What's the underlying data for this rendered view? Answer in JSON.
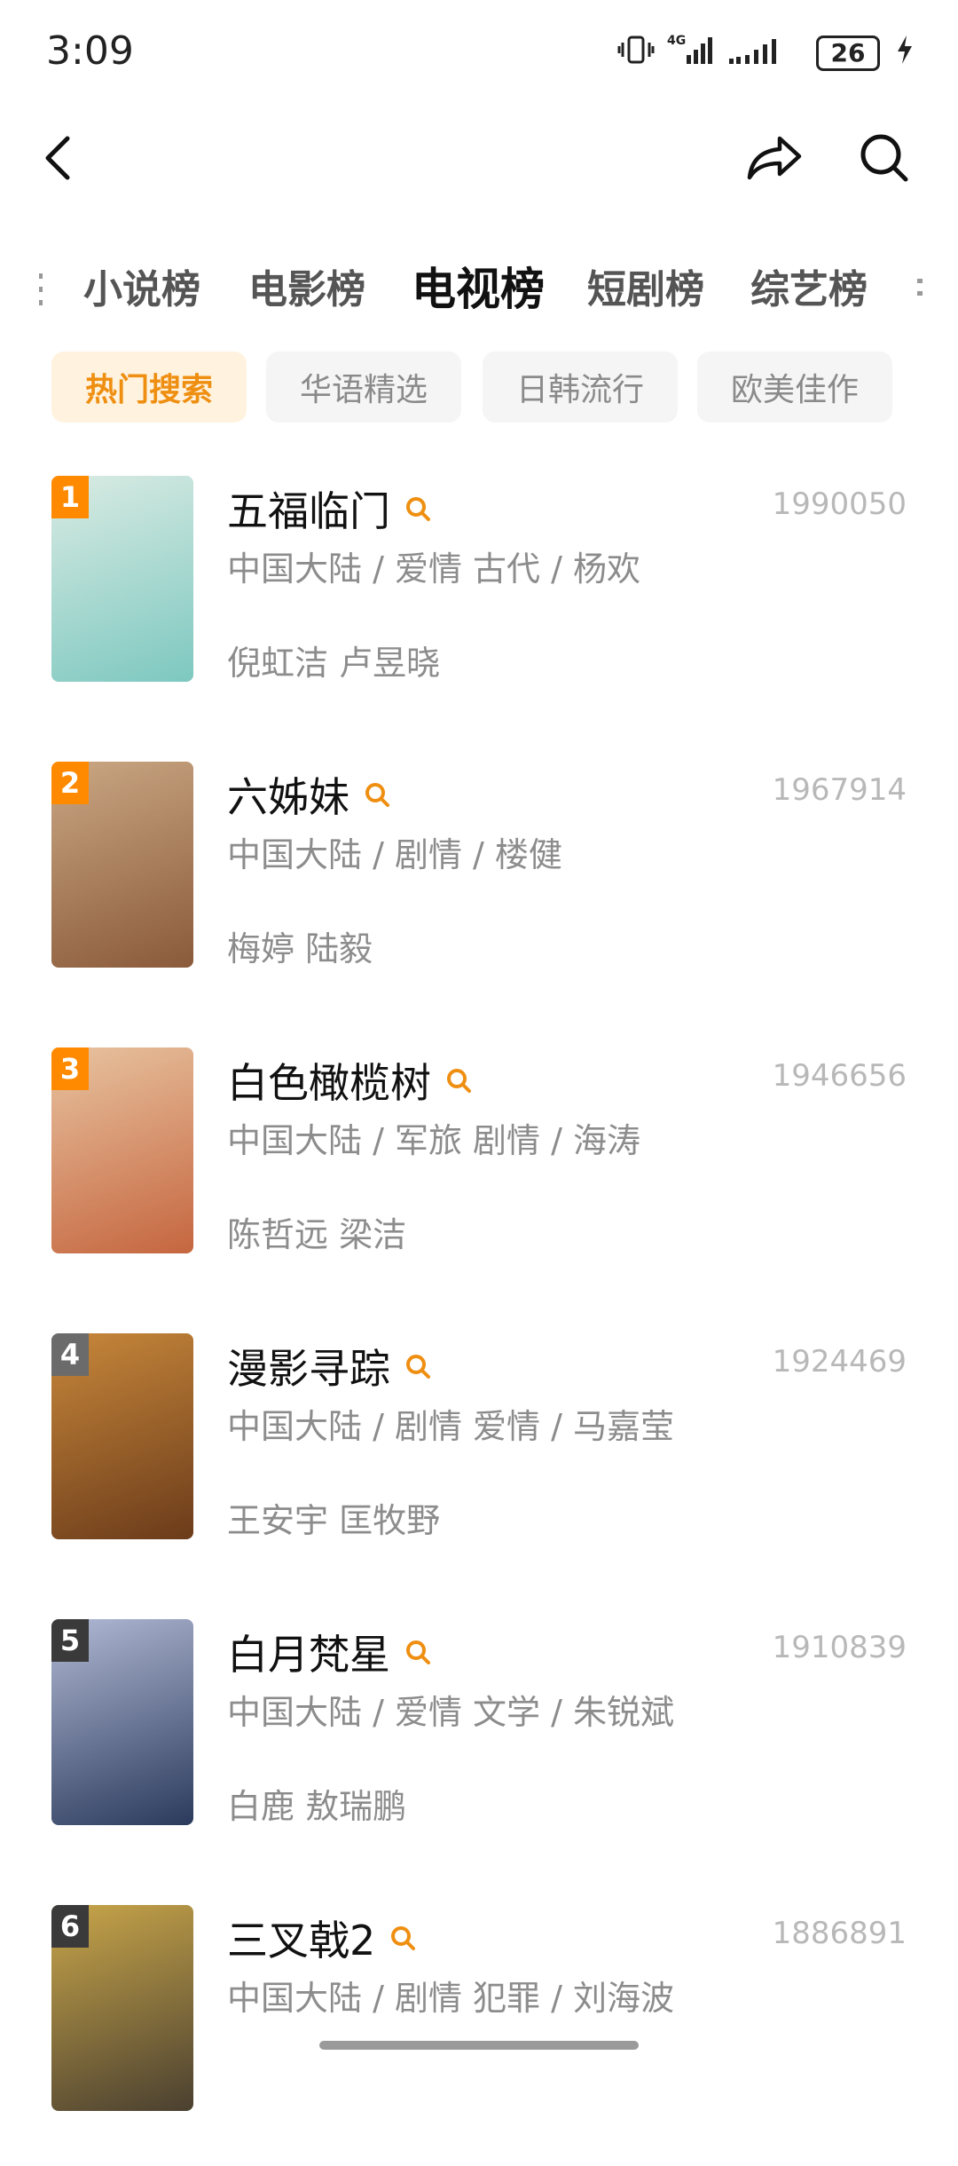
{
  "status": {
    "time": "3:09",
    "battery": "26",
    "network": "4G"
  },
  "tabs": [
    "小说榜",
    "电影榜",
    "电视榜",
    "短剧榜",
    "综艺榜"
  ],
  "active_tab": 2,
  "chips": [
    "热门搜索",
    "华语精选",
    "日韩流行",
    "欧美佳作"
  ],
  "active_chip": 0,
  "items": [
    {
      "rank": "1",
      "title": "五福临门",
      "count": "1990050",
      "meta": "中国大陆 / 爱情 古代 / 杨欢",
      "cast": "倪虹洁 卢昱晓",
      "colors": [
        "#7dc8c0",
        "#d9ebe3"
      ]
    },
    {
      "rank": "2",
      "title": "六姊妹",
      "count": "1967914",
      "meta": "中国大陆 / 剧情 / 楼健",
      "cast": "梅婷 陆毅",
      "colors": [
        "#8a5a3a",
        "#caa784"
      ]
    },
    {
      "rank": "3",
      "title": "白色橄榄树",
      "count": "1946656",
      "meta": "中国大陆 / 军旅 剧情 / 海涛",
      "cast": "陈哲远 梁洁",
      "colors": [
        "#c5663f",
        "#e8c3a0"
      ]
    },
    {
      "rank": "4",
      "title": "漫影寻踪",
      "count": "1924469",
      "meta": "中国大陆 / 剧情 爱情 / 马嘉莹",
      "cast": "王安宇 匡牧野",
      "colors": [
        "#6b3b1a",
        "#c8883b"
      ]
    },
    {
      "rank": "5",
      "title": "白月梵星",
      "count": "1910839",
      "meta": "中国大陆 / 爱情 文学 / 朱锐斌",
      "cast": "白鹿 敖瑞鹏",
      "colors": [
        "#2b3a5c",
        "#b0b9d4"
      ]
    },
    {
      "rank": "6",
      "title": "三叉戟2",
      "count": "1886891",
      "meta": "中国大陆 / 剧情 犯罪 / 刘海波",
      "cast": "",
      "colors": [
        "#4a4030",
        "#c9a64a"
      ]
    }
  ],
  "rank_colors": [
    "#ff8a00",
    "#ff8a00",
    "#ff8a00",
    "#6b6b6b",
    "#3a3a3a",
    "#3a3a3a"
  ],
  "accent_color": "#ef8f12"
}
